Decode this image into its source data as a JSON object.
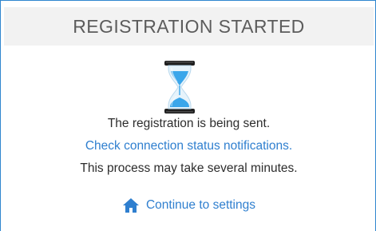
{
  "header": {
    "title": "REGISTRATION STARTED"
  },
  "status": {
    "icon": "hourglass-icon",
    "line1": "The registration is being sent.",
    "link_text": "Check connection status notifications.",
    "line3": "This process may take several minutes."
  },
  "actions": {
    "continue_icon": "home-icon",
    "continue_label": "Continue to settings"
  },
  "colors": {
    "border": "#2f86cf",
    "header_bg": "#f2f2f2",
    "header_text": "#5c5c5c",
    "link": "#2f7fcf",
    "body_text": "#2d2d2d",
    "sand": "#3aa6ea"
  }
}
